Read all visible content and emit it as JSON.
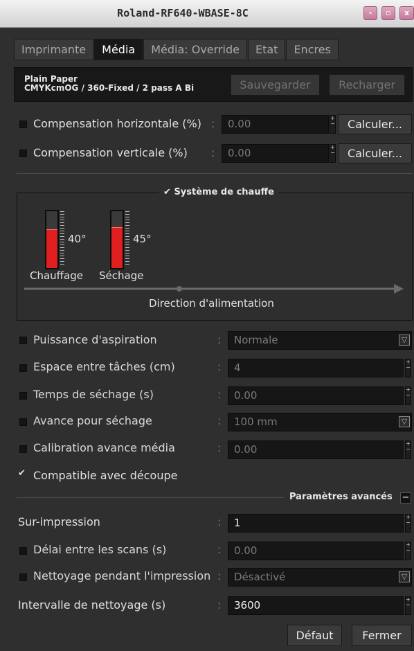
{
  "window": {
    "title": "Roland-RF640-WBASE-8C",
    "btn_min": "-",
    "btn_max": "▫",
    "btn_close": "x"
  },
  "tabs": [
    "Imprimante",
    "Média",
    "Média: Override",
    "Etat",
    "Encres"
  ],
  "media": {
    "line1": "Plain Paper",
    "line2": "CMYKcmOG / 360-Fixed / 2 pass A Bi",
    "save": "Sauvegarder",
    "reload": "Recharger"
  },
  "compensation": {
    "horizontal_label": "Compensation horizontale (%)",
    "horizontal_value": "0.00",
    "vertical_label": "Compensation verticale (%)",
    "vertical_value": "0.00",
    "calc": "Calculer...",
    "colon": ":"
  },
  "heating": {
    "title": "Système de chauffe",
    "check": "✔",
    "pre_temp": "40°",
    "pre_label": "Chauffage",
    "pre_level": 0.68,
    "dry_temp": "45°",
    "dry_label": "Séchage",
    "dry_level": 0.72,
    "direction": "Direction d'alimentation",
    "color": "#e02020"
  },
  "settings": {
    "suction_label": "Puissance d'aspiration",
    "suction_value": "Normale",
    "gap_label": "Espace entre tâches (cm)",
    "gap_value": "4",
    "drytime_label": "Temps de séchage (s)",
    "drytime_value": "0.00",
    "feed_label": "Avance pour séchage",
    "feed_value": "100 mm",
    "calib_label": "Calibration avance média",
    "calib_value": "0.00",
    "cut_label": "Compatible avec découpe",
    "cut_check": "✔"
  },
  "advanced": {
    "title": "Paramètres avancés",
    "toggle": "−",
    "overprint_label": "Sur-impression",
    "overprint_value": "1",
    "scan_delay_label": "Délai entre les scans (s)",
    "scan_delay_value": "0.00",
    "cleaning_label": "Nettoyage pendant l'impression",
    "cleaning_value": "Désactivé",
    "interval_label": "Intervalle de nettoyage (s)",
    "interval_value": "3600"
  },
  "footer": {
    "default": "Défaut",
    "close": "Fermer"
  }
}
